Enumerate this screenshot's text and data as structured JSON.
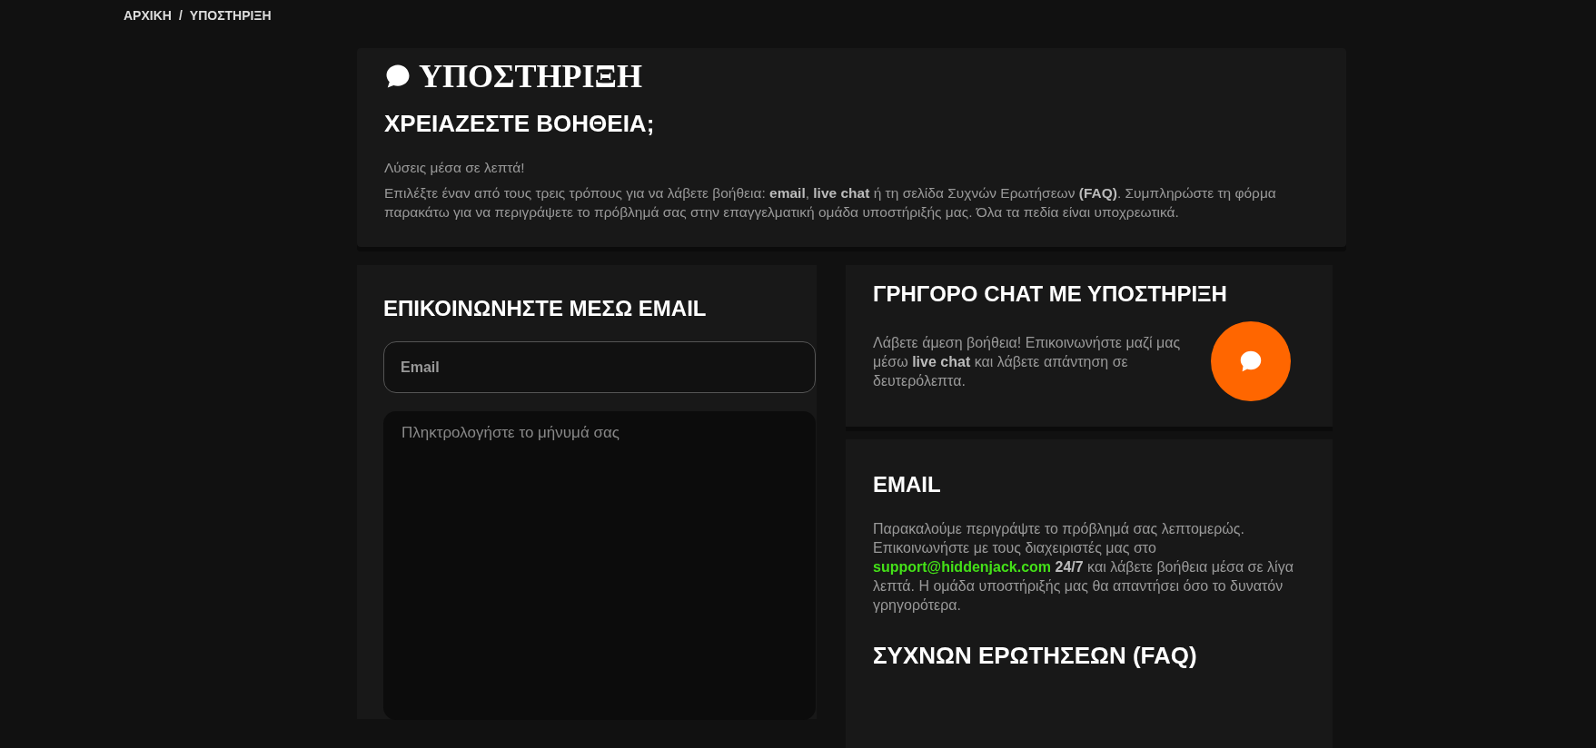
{
  "breadcrumb": [
    {
      "label": "ΑΡΧΙΚΗ"
    },
    {
      "label": "ΥΠΟΣΤΗΡΙΞΗ"
    }
  ],
  "breadcrumb_separator": "/",
  "header": {
    "title": "ΥΠΟΣΤΗΡΙΞΗ",
    "subtitle": "ΧΡΕΙΑΖΕΣΤΕ ΒΟΗΘΕΙΑ;",
    "tagline": "Λύσεις μέσα σε λεπτά!",
    "description": "Επιλέξτε έναν από τους τρεις τρόπους για να λάβετε βοήθεια: **email**, **live chat** ή τη σελίδα Συχνών Ερωτήσεων **(FAQ)**. Συμπληρώστε τη φόρμα παρακάτω για να περιγράψετε το πρόβλημά σας στην επαγγελματική ομάδα υποστήριξής μας. Όλα τα πεδία είναι υποχρεωτικά."
  },
  "email_form": {
    "title": "ΕΠΙΚΟΙΝΩΝΗΣΤΕ ΜΕΣΩ EMAIL",
    "email": {
      "placeholder": "Email"
    },
    "message": {
      "placeholder": "Πληκτρολογήστε το μήνυμά σας"
    }
  },
  "chat_card": {
    "title": "ΓΡΗΓΟΡΟ CHAT ΜΕ ΥΠΟΣΤΗΡΙΞΗ",
    "text": "Λάβετε άμεση βοήθεια! Επικοινωνήστε μαζί μας μέσω **live chat** και λάβετε απάντηση σε δευτερόλεπτα."
  },
  "email_card": {
    "title": "EMAIL",
    "text_before": "Παρακαλούμε περιγράψτε το πρόβλημά σας λεπτομερώς. Επικοινωνήστε με τους διαχειριστές μας στο",
    "link": "support@hiddenjack.com",
    "text_after": "**24/7** και λάβετε βοήθεια μέσα σε λίγα λεπτά. Η ομάδα υποστήριξής μας θα απαντήσει όσο το δυνατόν γρηγορότερα.",
    "faq_title": "ΣΥΧΝΩΝ ΕΡΩΤΗΣΕΩΝ (FAQ)"
  }
}
